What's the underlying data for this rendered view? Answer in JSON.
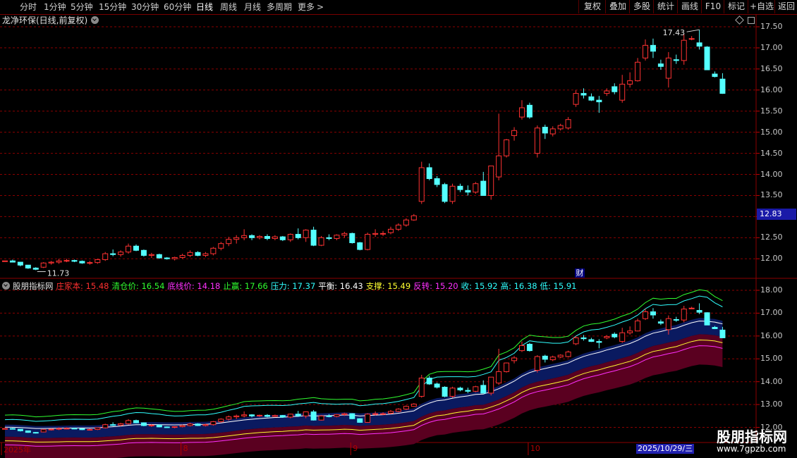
{
  "toolbar": {
    "periods": [
      "分时",
      "1分钟",
      "5分钟",
      "15分钟",
      "30分钟",
      "60分钟",
      "日线",
      "周线",
      "月线",
      "多周期",
      "更多"
    ],
    "active_period": "日线",
    "more_arrow": ">",
    "buttons": [
      "复权",
      "叠加",
      "多股",
      "统计",
      "画线",
      "F10",
      "标记",
      "+自选",
      "返回"
    ]
  },
  "stock": {
    "title": "龙净环保(日线,前复权)"
  },
  "price_panel": {
    "y_axis_ticks": [
      "17.50",
      "17.00",
      "16.50",
      "16.00",
      "15.50",
      "15.00",
      "14.50",
      "14.00",
      "13.50",
      "13.00",
      "12.50",
      "12.00"
    ],
    "current_price": "12.83",
    "high_marker": "17.43",
    "low_marker": "11.73",
    "event_badge": "财"
  },
  "indicator": {
    "name": "股朋指标网",
    "values": [
      {
        "label": "庄家本:",
        "value": "15.48",
        "color": "#ff3030"
      },
      {
        "label": "清仓价:",
        "value": "16.54",
        "color": "#30ff30"
      },
      {
        "label": "底线价:",
        "value": "14.18",
        "color": "#ff30ff"
      },
      {
        "label": "止赢:",
        "value": "17.66",
        "color": "#30ff30"
      },
      {
        "label": "压力:",
        "value": "17.37",
        "color": "#30ffff"
      },
      {
        "label": "平衡:",
        "value": "16.43",
        "color": "#ffffff"
      },
      {
        "label": "支撑:",
        "value": "15.49",
        "color": "#ffff30"
      },
      {
        "label": "反转:",
        "value": "15.20",
        "color": "#ff30ff"
      },
      {
        "label": "收:",
        "value": "15.92",
        "color": "#30ffff"
      },
      {
        "label": "高:",
        "value": "16.38",
        "color": "#30ffff"
      },
      {
        "label": "低:",
        "value": "15.91",
        "color": "#30ffff"
      }
    ],
    "y_axis_ticks": [
      "18.00",
      "17.00",
      "16.00",
      "15.00",
      "14.00",
      "13.00",
      "12.00"
    ]
  },
  "date_axis": {
    "labels": [
      "2025年",
      "8",
      "9",
      "10"
    ],
    "selected_date": "2025/10/29/三"
  },
  "watermark": {
    "text": "股朋指标网",
    "url": "www.7gpzb.com"
  },
  "colors": {
    "up": "#ff3232",
    "down": "#54ffff",
    "grid": "#8b0000",
    "band_fill": "#0a1a60",
    "lower_band_fill": "#5a0020"
  },
  "chart_data": {
    "type": "candlestick",
    "ohlc": [
      [
        11.95,
        11.95,
        11.95,
        11.95
      ],
      [
        11.95,
        11.98,
        11.92,
        11.92
      ],
      [
        11.92,
        11.92,
        11.82,
        11.85
      ],
      [
        11.85,
        11.85,
        11.76,
        11.78
      ],
      [
        11.78,
        11.8,
        11.73,
        11.75
      ],
      [
        11.8,
        11.92,
        11.78,
        11.9
      ],
      [
        11.9,
        11.95,
        11.86,
        11.92
      ],
      [
        11.92,
        12.0,
        11.88,
        11.95
      ],
      [
        11.95,
        12.0,
        11.92,
        11.96
      ],
      [
        11.96,
        11.98,
        11.92,
        11.94
      ],
      [
        11.94,
        11.96,
        11.88,
        11.9
      ],
      [
        11.9,
        11.95,
        11.86,
        11.91
      ],
      [
        11.91,
        12.0,
        11.88,
        11.98
      ],
      [
        11.98,
        12.16,
        11.95,
        12.12
      ],
      [
        12.12,
        12.22,
        12.06,
        12.1
      ],
      [
        12.1,
        12.2,
        12.05,
        12.16
      ],
      [
        12.16,
        12.36,
        12.12,
        12.3
      ],
      [
        12.3,
        12.34,
        12.18,
        12.2
      ],
      [
        12.2,
        12.22,
        12.05,
        12.08
      ],
      [
        12.08,
        12.14,
        12.02,
        12.1
      ],
      [
        12.1,
        12.12,
        12.0,
        12.02
      ],
      [
        12.02,
        12.04,
        11.98,
        12.0
      ],
      [
        12.0,
        12.05,
        11.96,
        12.03
      ],
      [
        12.03,
        12.12,
        12.0,
        12.08
      ],
      [
        12.08,
        12.2,
        12.04,
        12.15
      ],
      [
        12.15,
        12.18,
        12.06,
        12.08
      ],
      [
        12.08,
        12.16,
        12.04,
        12.12
      ],
      [
        12.12,
        12.28,
        12.08,
        12.25
      ],
      [
        12.25,
        12.4,
        12.2,
        12.36
      ],
      [
        12.36,
        12.52,
        12.3,
        12.46
      ],
      [
        12.46,
        12.56,
        12.36,
        12.5
      ],
      [
        12.5,
        12.7,
        12.44,
        12.55
      ],
      [
        12.55,
        12.58,
        12.44,
        12.5
      ],
      [
        12.5,
        12.56,
        12.46,
        12.53
      ],
      [
        12.53,
        12.58,
        12.44,
        12.48
      ],
      [
        12.48,
        12.56,
        12.44,
        12.52
      ],
      [
        12.52,
        12.54,
        12.42,
        12.45
      ],
      [
        12.45,
        12.6,
        12.4,
        12.58
      ],
      [
        12.58,
        12.72,
        12.46,
        12.5
      ],
      [
        12.5,
        12.7,
        12.4,
        12.68
      ],
      [
        12.68,
        12.76,
        12.3,
        12.32
      ],
      [
        12.32,
        12.54,
        12.3,
        12.5
      ],
      [
        12.5,
        12.58,
        12.44,
        12.48
      ],
      [
        12.48,
        12.58,
        12.44,
        12.56
      ],
      [
        12.56,
        12.64,
        12.5,
        12.6
      ],
      [
        12.6,
        12.62,
        12.36,
        12.38
      ],
      [
        12.38,
        12.4,
        12.2,
        12.22
      ],
      [
        12.22,
        12.62,
        12.2,
        12.58
      ],
      [
        12.58,
        12.7,
        12.52,
        12.6
      ],
      [
        12.6,
        12.66,
        12.54,
        12.6
      ],
      [
        12.62,
        12.76,
        12.58,
        12.7
      ],
      [
        12.7,
        12.84,
        12.66,
        12.8
      ],
      [
        12.8,
        12.96,
        12.76,
        12.92
      ],
      [
        12.92,
        13.06,
        12.9,
        13.02
      ],
      [
        13.36,
        14.3,
        13.3,
        14.16
      ],
      [
        14.16,
        14.26,
        13.86,
        13.9
      ],
      [
        13.9,
        13.96,
        13.7,
        13.76
      ],
      [
        13.76,
        13.8,
        13.32,
        13.36
      ],
      [
        13.36,
        13.78,
        13.3,
        13.72
      ],
      [
        13.72,
        13.78,
        13.58,
        13.64
      ],
      [
        13.62,
        13.74,
        13.5,
        13.58
      ],
      [
        13.58,
        13.82,
        13.54,
        13.78
      ],
      [
        13.84,
        14.06,
        13.8,
        13.5
      ],
      [
        13.5,
        14.2,
        13.4,
        14.2
      ],
      [
        13.94,
        15.44,
        13.86,
        14.44
      ],
      [
        14.44,
        14.84,
        14.4,
        14.82
      ],
      [
        14.92,
        15.12,
        14.8,
        15.04
      ],
      [
        15.36,
        15.76,
        15.3,
        15.58
      ],
      [
        15.64,
        15.7,
        15.32,
        15.36
      ],
      [
        14.5,
        15.16,
        14.4,
        15.1
      ],
      [
        15.12,
        15.18,
        14.84,
        14.98
      ],
      [
        14.96,
        15.14,
        14.9,
        15.08
      ],
      [
        15.08,
        15.2,
        15.04,
        15.16
      ],
      [
        15.1,
        15.36,
        15.06,
        15.3
      ],
      [
        15.66,
        16.0,
        15.6,
        15.92
      ],
      [
        15.92,
        16.04,
        15.8,
        15.88
      ],
      [
        15.84,
        15.92,
        15.74,
        15.76
      ],
      [
        15.76,
        15.86,
        15.46,
        15.72
      ],
      [
        15.92,
        16.04,
        15.86,
        15.98
      ],
      [
        16.08,
        16.16,
        15.9,
        15.96
      ],
      [
        15.76,
        16.36,
        15.7,
        16.14
      ],
      [
        16.14,
        16.42,
        16.06,
        16.22
      ],
      [
        16.22,
        16.76,
        16.2,
        16.66
      ],
      [
        16.76,
        17.2,
        16.7,
        17.06
      ],
      [
        17.06,
        17.22,
        16.76,
        16.92
      ],
      [
        16.62,
        16.72,
        16.48,
        16.56
      ],
      [
        16.28,
        16.9,
        16.06,
        16.76
      ],
      [
        16.72,
        16.84,
        16.62,
        16.7
      ],
      [
        16.7,
        17.32,
        16.6,
        17.18
      ],
      [
        17.22,
        17.28,
        17.18,
        17.22
      ],
      [
        17.12,
        17.43,
        16.96,
        17.04
      ],
      [
        17.02,
        17.04,
        16.5,
        16.48
      ],
      [
        16.38,
        16.44,
        16.3,
        16.32
      ],
      [
        16.26,
        16.4,
        15.91,
        15.92
      ]
    ]
  }
}
